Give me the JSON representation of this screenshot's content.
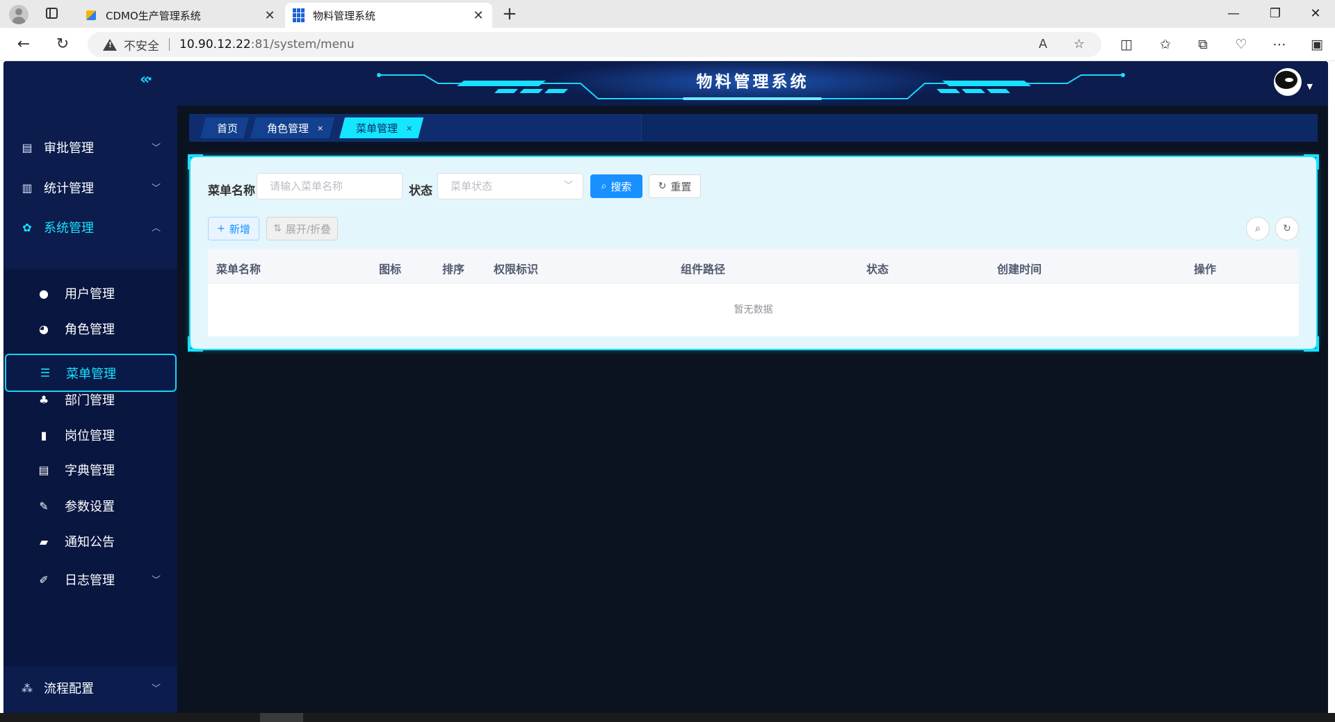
{
  "browser": {
    "tabs": [
      {
        "label": "CDMO生产管理系统",
        "close": "✕"
      },
      {
        "label": "物料管理系统",
        "close": "✕"
      }
    ],
    "new_tab": "+",
    "security_label": "不安全",
    "url_host": "10.90.12.22",
    "url_rest": ":81/system/menu"
  },
  "app": {
    "title": "物料管理系统",
    "sidebar": {
      "collapse_icon": "«·",
      "menus": [
        {
          "label": "审批管理",
          "icon": "approval-icon",
          "expanded": false
        },
        {
          "label": "统计管理",
          "icon": "chart-icon",
          "expanded": false
        },
        {
          "label": "系统管理",
          "icon": "gear-icon",
          "expanded": true
        },
        {
          "label": "流程配置",
          "icon": "flow-icon",
          "expanded": false
        }
      ],
      "sub_items": [
        {
          "label": "用户管理",
          "icon": "user-icon"
        },
        {
          "label": "角色管理",
          "icon": "role-icon"
        },
        {
          "label": "菜单管理",
          "icon": "tree-table-icon"
        },
        {
          "label": "部门管理",
          "icon": "org-tree-icon"
        },
        {
          "label": "岗位管理",
          "icon": "post-icon"
        },
        {
          "label": "字典管理",
          "icon": "dict-icon"
        },
        {
          "label": "参数设置",
          "icon": "edit-icon"
        },
        {
          "label": "通知公告",
          "icon": "message-icon"
        },
        {
          "label": "日志管理",
          "icon": "log-icon"
        }
      ]
    },
    "tags": [
      {
        "label": "首页"
      },
      {
        "label": "角色管理",
        "close": "×"
      },
      {
        "label": "菜单管理",
        "close": "×"
      }
    ],
    "search": {
      "name_label": "菜单名称",
      "name_placeholder": "请输入菜单名称",
      "status_label": "状态",
      "status_placeholder": "菜单状态",
      "search_button": "搜索",
      "reset_button": "重置"
    },
    "toolbar": {
      "add_button": "新增",
      "toggle_button": "展开/折叠"
    },
    "table": {
      "columns": [
        "菜单名称",
        "图标",
        "排序",
        "权限标识",
        "组件路径",
        "状态",
        "创建时间",
        "操作"
      ],
      "empty_text": "暂无数据"
    },
    "colors": {
      "accent": "#19e0ff",
      "sidebar_bg": "#0b1c4d",
      "primary": "#1890ff"
    }
  }
}
